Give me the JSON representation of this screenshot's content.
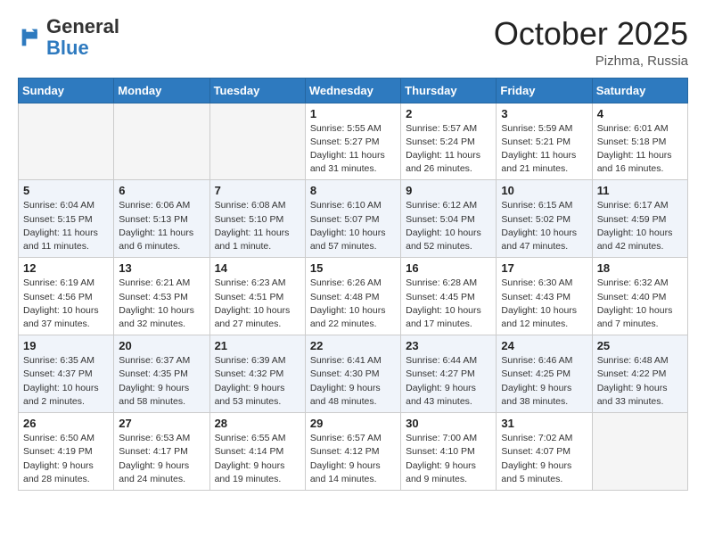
{
  "header": {
    "logo_general": "General",
    "logo_blue": "Blue",
    "month": "October 2025",
    "location": "Pizhma, Russia"
  },
  "days_of_week": [
    "Sunday",
    "Monday",
    "Tuesday",
    "Wednesday",
    "Thursday",
    "Friday",
    "Saturday"
  ],
  "weeks": [
    [
      {
        "day": "",
        "info": ""
      },
      {
        "day": "",
        "info": ""
      },
      {
        "day": "",
        "info": ""
      },
      {
        "day": "1",
        "info": "Sunrise: 5:55 AM\nSunset: 5:27 PM\nDaylight: 11 hours\nand 31 minutes."
      },
      {
        "day": "2",
        "info": "Sunrise: 5:57 AM\nSunset: 5:24 PM\nDaylight: 11 hours\nand 26 minutes."
      },
      {
        "day": "3",
        "info": "Sunrise: 5:59 AM\nSunset: 5:21 PM\nDaylight: 11 hours\nand 21 minutes."
      },
      {
        "day": "4",
        "info": "Sunrise: 6:01 AM\nSunset: 5:18 PM\nDaylight: 11 hours\nand 16 minutes."
      }
    ],
    [
      {
        "day": "5",
        "info": "Sunrise: 6:04 AM\nSunset: 5:15 PM\nDaylight: 11 hours\nand 11 minutes."
      },
      {
        "day": "6",
        "info": "Sunrise: 6:06 AM\nSunset: 5:13 PM\nDaylight: 11 hours\nand 6 minutes."
      },
      {
        "day": "7",
        "info": "Sunrise: 6:08 AM\nSunset: 5:10 PM\nDaylight: 11 hours\nand 1 minute."
      },
      {
        "day": "8",
        "info": "Sunrise: 6:10 AM\nSunset: 5:07 PM\nDaylight: 10 hours\nand 57 minutes."
      },
      {
        "day": "9",
        "info": "Sunrise: 6:12 AM\nSunset: 5:04 PM\nDaylight: 10 hours\nand 52 minutes."
      },
      {
        "day": "10",
        "info": "Sunrise: 6:15 AM\nSunset: 5:02 PM\nDaylight: 10 hours\nand 47 minutes."
      },
      {
        "day": "11",
        "info": "Sunrise: 6:17 AM\nSunset: 4:59 PM\nDaylight: 10 hours\nand 42 minutes."
      }
    ],
    [
      {
        "day": "12",
        "info": "Sunrise: 6:19 AM\nSunset: 4:56 PM\nDaylight: 10 hours\nand 37 minutes."
      },
      {
        "day": "13",
        "info": "Sunrise: 6:21 AM\nSunset: 4:53 PM\nDaylight: 10 hours\nand 32 minutes."
      },
      {
        "day": "14",
        "info": "Sunrise: 6:23 AM\nSunset: 4:51 PM\nDaylight: 10 hours\nand 27 minutes."
      },
      {
        "day": "15",
        "info": "Sunrise: 6:26 AM\nSunset: 4:48 PM\nDaylight: 10 hours\nand 22 minutes."
      },
      {
        "day": "16",
        "info": "Sunrise: 6:28 AM\nSunset: 4:45 PM\nDaylight: 10 hours\nand 17 minutes."
      },
      {
        "day": "17",
        "info": "Sunrise: 6:30 AM\nSunset: 4:43 PM\nDaylight: 10 hours\nand 12 minutes."
      },
      {
        "day": "18",
        "info": "Sunrise: 6:32 AM\nSunset: 4:40 PM\nDaylight: 10 hours\nand 7 minutes."
      }
    ],
    [
      {
        "day": "19",
        "info": "Sunrise: 6:35 AM\nSunset: 4:37 PM\nDaylight: 10 hours\nand 2 minutes."
      },
      {
        "day": "20",
        "info": "Sunrise: 6:37 AM\nSunset: 4:35 PM\nDaylight: 9 hours\nand 58 minutes."
      },
      {
        "day": "21",
        "info": "Sunrise: 6:39 AM\nSunset: 4:32 PM\nDaylight: 9 hours\nand 53 minutes."
      },
      {
        "day": "22",
        "info": "Sunrise: 6:41 AM\nSunset: 4:30 PM\nDaylight: 9 hours\nand 48 minutes."
      },
      {
        "day": "23",
        "info": "Sunrise: 6:44 AM\nSunset: 4:27 PM\nDaylight: 9 hours\nand 43 minutes."
      },
      {
        "day": "24",
        "info": "Sunrise: 6:46 AM\nSunset: 4:25 PM\nDaylight: 9 hours\nand 38 minutes."
      },
      {
        "day": "25",
        "info": "Sunrise: 6:48 AM\nSunset: 4:22 PM\nDaylight: 9 hours\nand 33 minutes."
      }
    ],
    [
      {
        "day": "26",
        "info": "Sunrise: 6:50 AM\nSunset: 4:19 PM\nDaylight: 9 hours\nand 28 minutes."
      },
      {
        "day": "27",
        "info": "Sunrise: 6:53 AM\nSunset: 4:17 PM\nDaylight: 9 hours\nand 24 minutes."
      },
      {
        "day": "28",
        "info": "Sunrise: 6:55 AM\nSunset: 4:14 PM\nDaylight: 9 hours\nand 19 minutes."
      },
      {
        "day": "29",
        "info": "Sunrise: 6:57 AM\nSunset: 4:12 PM\nDaylight: 9 hours\nand 14 minutes."
      },
      {
        "day": "30",
        "info": "Sunrise: 7:00 AM\nSunset: 4:10 PM\nDaylight: 9 hours\nand 9 minutes."
      },
      {
        "day": "31",
        "info": "Sunrise: 7:02 AM\nSunset: 4:07 PM\nDaylight: 9 hours\nand 5 minutes."
      },
      {
        "day": "",
        "info": ""
      }
    ]
  ]
}
